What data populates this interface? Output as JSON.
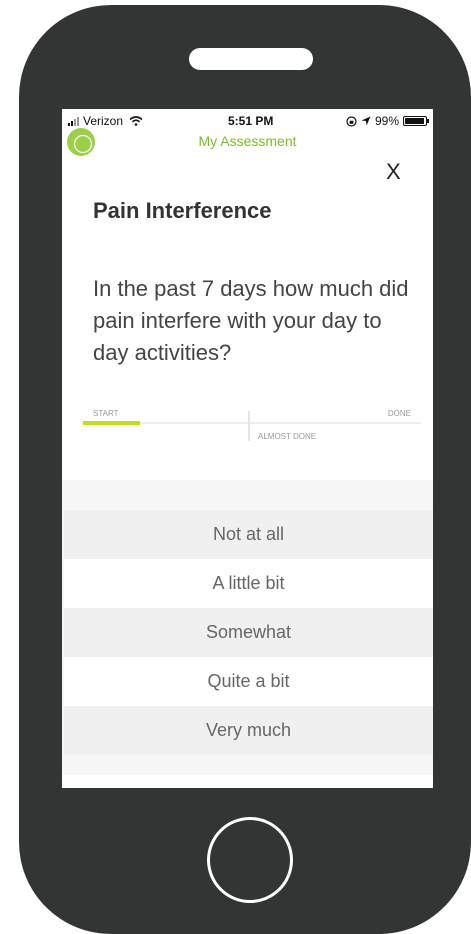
{
  "status_bar": {
    "carrier": "Verizon",
    "time": "5:51 PM",
    "battery": "99%",
    "icons": [
      "signal-icon",
      "wifi-icon",
      "lock-rotation-icon",
      "location-arrow-icon",
      "battery-icon"
    ]
  },
  "header": {
    "title": "My Assessment",
    "close_label": "X"
  },
  "section_title": "Pain Interference",
  "question": "In the past 7 days how much did pain interfere with your day to day activities?",
  "progress": {
    "start_label": "START",
    "almost_label": "ALMOST DONE",
    "done_label": "DONE",
    "value_fraction": 0.17
  },
  "options": [
    {
      "label": "Not at all"
    },
    {
      "label": "A little bit"
    },
    {
      "label": "Somewhat"
    },
    {
      "label": "Quite a bit"
    },
    {
      "label": "Very much"
    }
  ],
  "colors": {
    "accent": "#7dba32",
    "progress_fill": "#c4dc14",
    "phone_body": "#333535"
  }
}
